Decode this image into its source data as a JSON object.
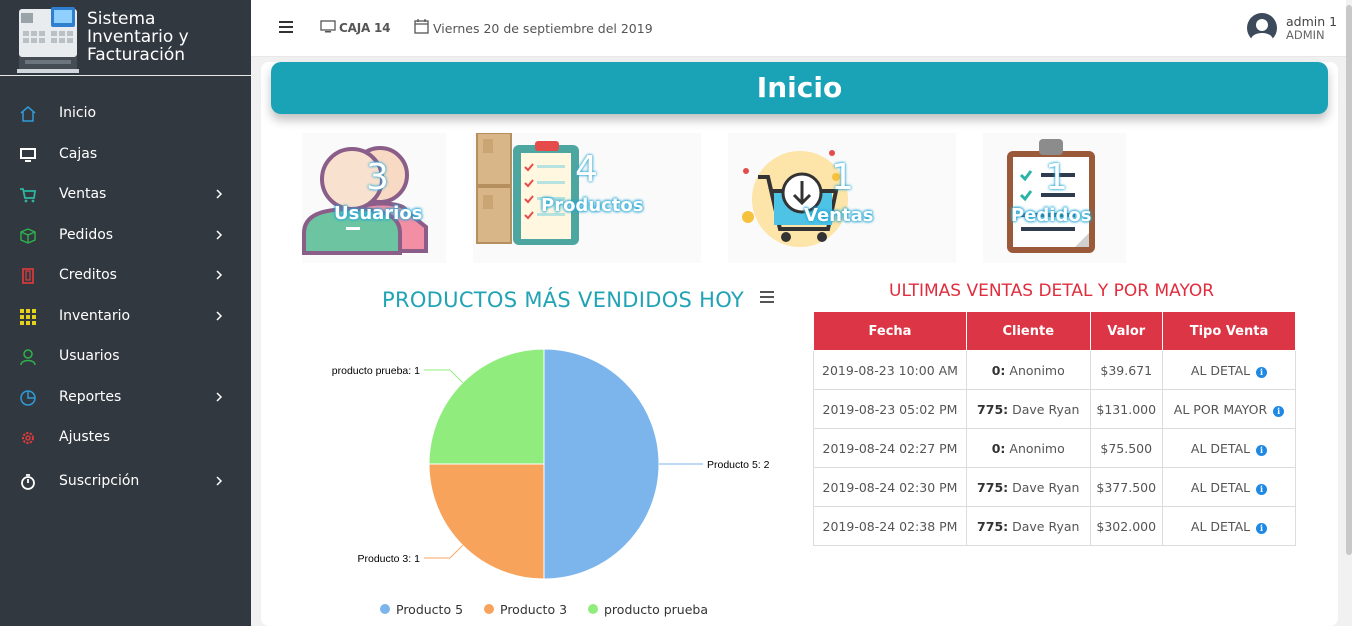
{
  "brand": {
    "line1": "Sistema",
    "line2": "Inventario y",
    "line3": "Facturación"
  },
  "sidebar": {
    "items": [
      {
        "label": "Inicio",
        "icon": "home-icon",
        "color": "#2f9bd6"
      },
      {
        "label": "Cajas",
        "icon": "monitor-icon",
        "color": "#ffffff"
      },
      {
        "label": "Ventas",
        "icon": "cart-icon",
        "color": "#2db5a0"
      },
      {
        "label": "Pedidos",
        "icon": "box-icon",
        "color": "#2db34a"
      },
      {
        "label": "Creditos",
        "icon": "book-icon",
        "color": "#e23b3b"
      },
      {
        "label": "Inventario",
        "icon": "grid-icon",
        "color": "#e5d21c"
      },
      {
        "label": "Usuarios",
        "icon": "user-icon",
        "color": "#2db34a"
      },
      {
        "label": "Reportes",
        "icon": "pie-icon",
        "color": "#2f9bd6"
      },
      {
        "label": "Ajustes",
        "icon": "gear-icon",
        "color": "#e23b3b"
      },
      {
        "label": "Suscripción",
        "icon": "stopwatch-icon",
        "color": "#ffffff"
      }
    ]
  },
  "topbar": {
    "caja": "CAJA 14",
    "fecha": "Viernes 20 de septiembre del 2019",
    "user_name": "admin 1",
    "user_role": "ADMIN"
  },
  "main": {
    "title": "Inicio",
    "stats": [
      {
        "value": "3",
        "label": "Usuarios"
      },
      {
        "value": "4",
        "label": "Productos"
      },
      {
        "value": "1",
        "label": "Ventas"
      },
      {
        "value": "1",
        "label": "Pedidos"
      }
    ]
  },
  "chart_data": {
    "type": "pie",
    "title": "PRODUCTOS MÁS VENDIDOS HOY",
    "series": [
      {
        "name": "Producto 5",
        "value": 2,
        "color": "#7cb5ec",
        "data_label": "Producto 5: 2"
      },
      {
        "name": "Producto 3",
        "value": 1,
        "color": "#f7a35c",
        "data_label": "Producto 3: 1"
      },
      {
        "name": "producto prueba",
        "value": 1,
        "color": "#90ed7d",
        "data_label": "producto prueba: 1"
      }
    ],
    "legend_position": "bottom"
  },
  "ventas": {
    "title": "ULTIMAS VENTAS DETAL Y POR MAYOR",
    "headers": [
      "Fecha",
      "Cliente",
      "Valor",
      "Tipo Venta"
    ],
    "rows": [
      {
        "fecha": "2019-08-23 10:00 AM",
        "cliente_id": "0:",
        "cliente": " Anonimo",
        "valor": "$39.671",
        "tipo": "AL DETAL"
      },
      {
        "fecha": "2019-08-23 05:02 PM",
        "cliente_id": "775:",
        "cliente": " Dave Ryan",
        "valor": "$131.000",
        "tipo": "AL POR MAYOR"
      },
      {
        "fecha": "2019-08-24 02:27 PM",
        "cliente_id": "0:",
        "cliente": " Anonimo",
        "valor": "$75.500",
        "tipo": "AL DETAL"
      },
      {
        "fecha": "2019-08-24 02:30 PM",
        "cliente_id": "775:",
        "cliente": " Dave Ryan",
        "valor": "$377.500",
        "tipo": "AL DETAL"
      },
      {
        "fecha": "2019-08-24 02:38 PM",
        "cliente_id": "775:",
        "cliente": " Dave Ryan",
        "valor": "$302.000",
        "tipo": "AL DETAL"
      }
    ]
  }
}
